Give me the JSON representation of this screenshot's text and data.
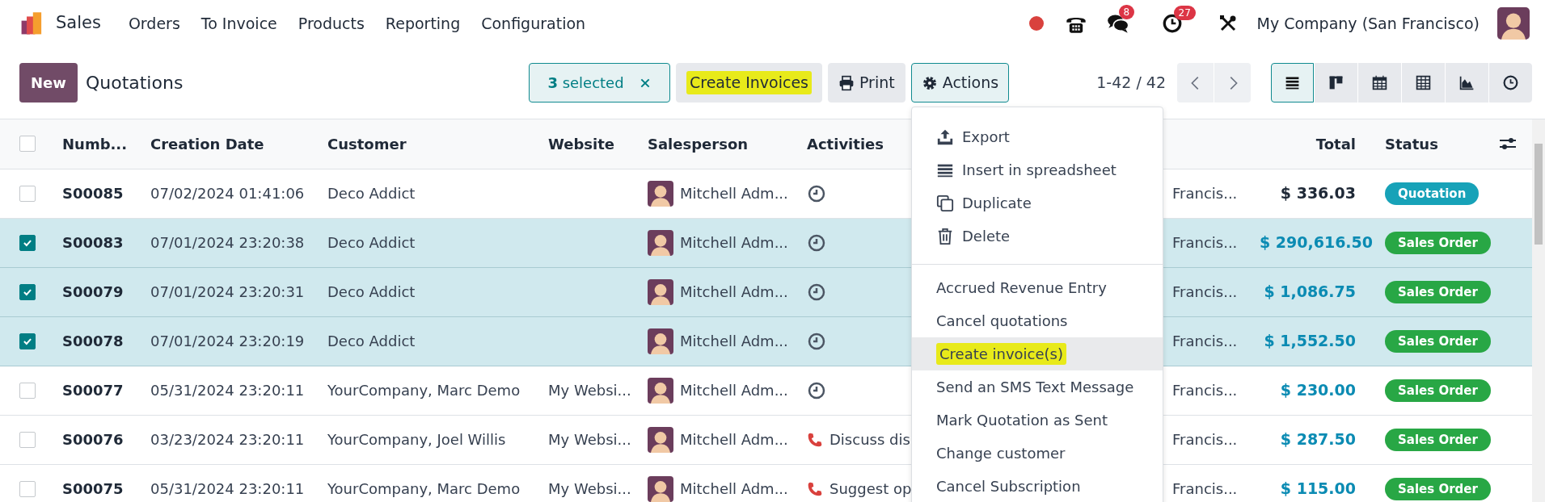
{
  "navbar": {
    "app_name": "Sales",
    "menus": [
      "Orders",
      "To Invoice",
      "Products",
      "Reporting",
      "Configuration"
    ],
    "messages_badge": "8",
    "activities_badge": "27",
    "company": "My Company (San Francisco)"
  },
  "control_panel": {
    "new_button": "New",
    "title": "Quotations",
    "selection": {
      "count": "3",
      "label": "selected"
    },
    "buttons": [
      {
        "label": "Create Invoices",
        "kind": "plain",
        "highlighted": true,
        "active": false
      },
      {
        "label": "Print",
        "kind": "print",
        "highlighted": false,
        "active": false
      },
      {
        "label": "Actions",
        "kind": "actions",
        "highlighted": false,
        "active": true
      }
    ],
    "pager": "1-42 / 42",
    "views": [
      {
        "kind": "list",
        "selected": true
      },
      {
        "kind": "kanban",
        "selected": false
      },
      {
        "kind": "calendar",
        "selected": false
      },
      {
        "kind": "pivot",
        "selected": false
      },
      {
        "kind": "graph",
        "selected": false
      },
      {
        "kind": "activity",
        "selected": false
      }
    ]
  },
  "table": {
    "all_selected": false,
    "columns": {
      "number": "Numb...",
      "creation_date": "Creation Date",
      "customer": "Customer",
      "website": "Website",
      "salesperson": "Salesperson",
      "activities": "Activities",
      "total": "Total",
      "status": "Status"
    },
    "rows": [
      {
        "selected": false,
        "number": "S00085",
        "creation_date": "07/02/2024 01:41:06",
        "customer": "Deco Addict",
        "website": "",
        "salesperson": "Mitchell Adm...",
        "activity": {
          "kind": "clock"
        },
        "column_8": "Francis...",
        "total": "$ 336.03",
        "status": {
          "kind": "quotation",
          "label": "Quotation"
        }
      },
      {
        "selected": true,
        "number": "S00083",
        "creation_date": "07/01/2024 23:20:38",
        "customer": "Deco Addict",
        "website": "",
        "salesperson": "Mitchell Adm...",
        "activity": {
          "kind": "clock"
        },
        "column_8": "Francis...",
        "total": "$ 290,616.50",
        "status": {
          "kind": "sales_order",
          "label": "Sales Order"
        }
      },
      {
        "selected": true,
        "number": "S00079",
        "creation_date": "07/01/2024 23:20:31",
        "customer": "Deco Addict",
        "website": "",
        "salesperson": "Mitchell Adm...",
        "activity": {
          "kind": "clock"
        },
        "column_8": "Francis...",
        "total": "$ 1,086.75",
        "status": {
          "kind": "sales_order",
          "label": "Sales Order"
        }
      },
      {
        "selected": true,
        "number": "S00078",
        "creation_date": "07/01/2024 23:20:19",
        "customer": "Deco Addict",
        "website": "",
        "salesperson": "Mitchell Adm...",
        "activity": {
          "kind": "clock"
        },
        "column_8": "Francis...",
        "total": "$ 1,552.50",
        "status": {
          "kind": "sales_order",
          "label": "Sales Order"
        }
      },
      {
        "selected": false,
        "number": "S00077",
        "creation_date": "05/31/2024 23:20:11",
        "customer": "YourCompany, Marc Demo",
        "website": "My Websi...",
        "salesperson": "Mitchell Adm...",
        "activity": {
          "kind": "clock"
        },
        "column_8": "Francis...",
        "total": "$ 230.00",
        "status": {
          "kind": "sales_order",
          "label": "Sales Order"
        }
      },
      {
        "selected": false,
        "number": "S00076",
        "creation_date": "03/23/2024 23:20:11",
        "customer": "YourCompany, Joel Willis",
        "website": "My Websi...",
        "salesperson": "Mitchell Adm...",
        "activity": {
          "kind": "call",
          "text": "Discuss dis"
        },
        "column_8": "Francis...",
        "total": "$ 287.50",
        "status": {
          "kind": "sales_order",
          "label": "Sales Order"
        }
      },
      {
        "selected": false,
        "number": "S00075",
        "creation_date": "05/31/2024 23:20:11",
        "customer": "YourCompany, Marc Demo",
        "website": "My Websi...",
        "salesperson": "Mitchell Adm...",
        "activity": {
          "kind": "call",
          "text": "Suggest op"
        },
        "column_8": "Francis...",
        "total": "$ 115.00",
        "status": {
          "kind": "sales_order",
          "label": "Sales Order"
        }
      }
    ]
  },
  "actions_menu": {
    "groups": [
      [
        {
          "label": "Export",
          "kind": "export",
          "hovered": false,
          "highlighted": false
        },
        {
          "label": "Insert in spreadsheet",
          "kind": "spreadsheet",
          "hovered": false,
          "highlighted": false
        },
        {
          "label": "Duplicate",
          "kind": "duplicate",
          "hovered": false,
          "highlighted": false
        },
        {
          "label": "Delete",
          "kind": "delete",
          "hovered": false,
          "highlighted": false
        }
      ],
      [
        {
          "label": "Accrued Revenue Entry",
          "kind": "action",
          "hovered": false,
          "highlighted": false
        },
        {
          "label": "Cancel quotations",
          "kind": "action",
          "hovered": false,
          "highlighted": false
        },
        {
          "label": "Create invoice(s)",
          "kind": "action",
          "hovered": true,
          "highlighted": true
        },
        {
          "label": "Send an SMS Text Message",
          "kind": "action",
          "hovered": false,
          "highlighted": false
        },
        {
          "label": "Mark Quotation as Sent",
          "kind": "action",
          "hovered": false,
          "highlighted": false
        },
        {
          "label": "Change customer",
          "kind": "action",
          "hovered": false,
          "highlighted": false
        },
        {
          "label": "Cancel Subscription",
          "kind": "action",
          "hovered": false,
          "highlighted": false
        }
      ]
    ]
  }
}
